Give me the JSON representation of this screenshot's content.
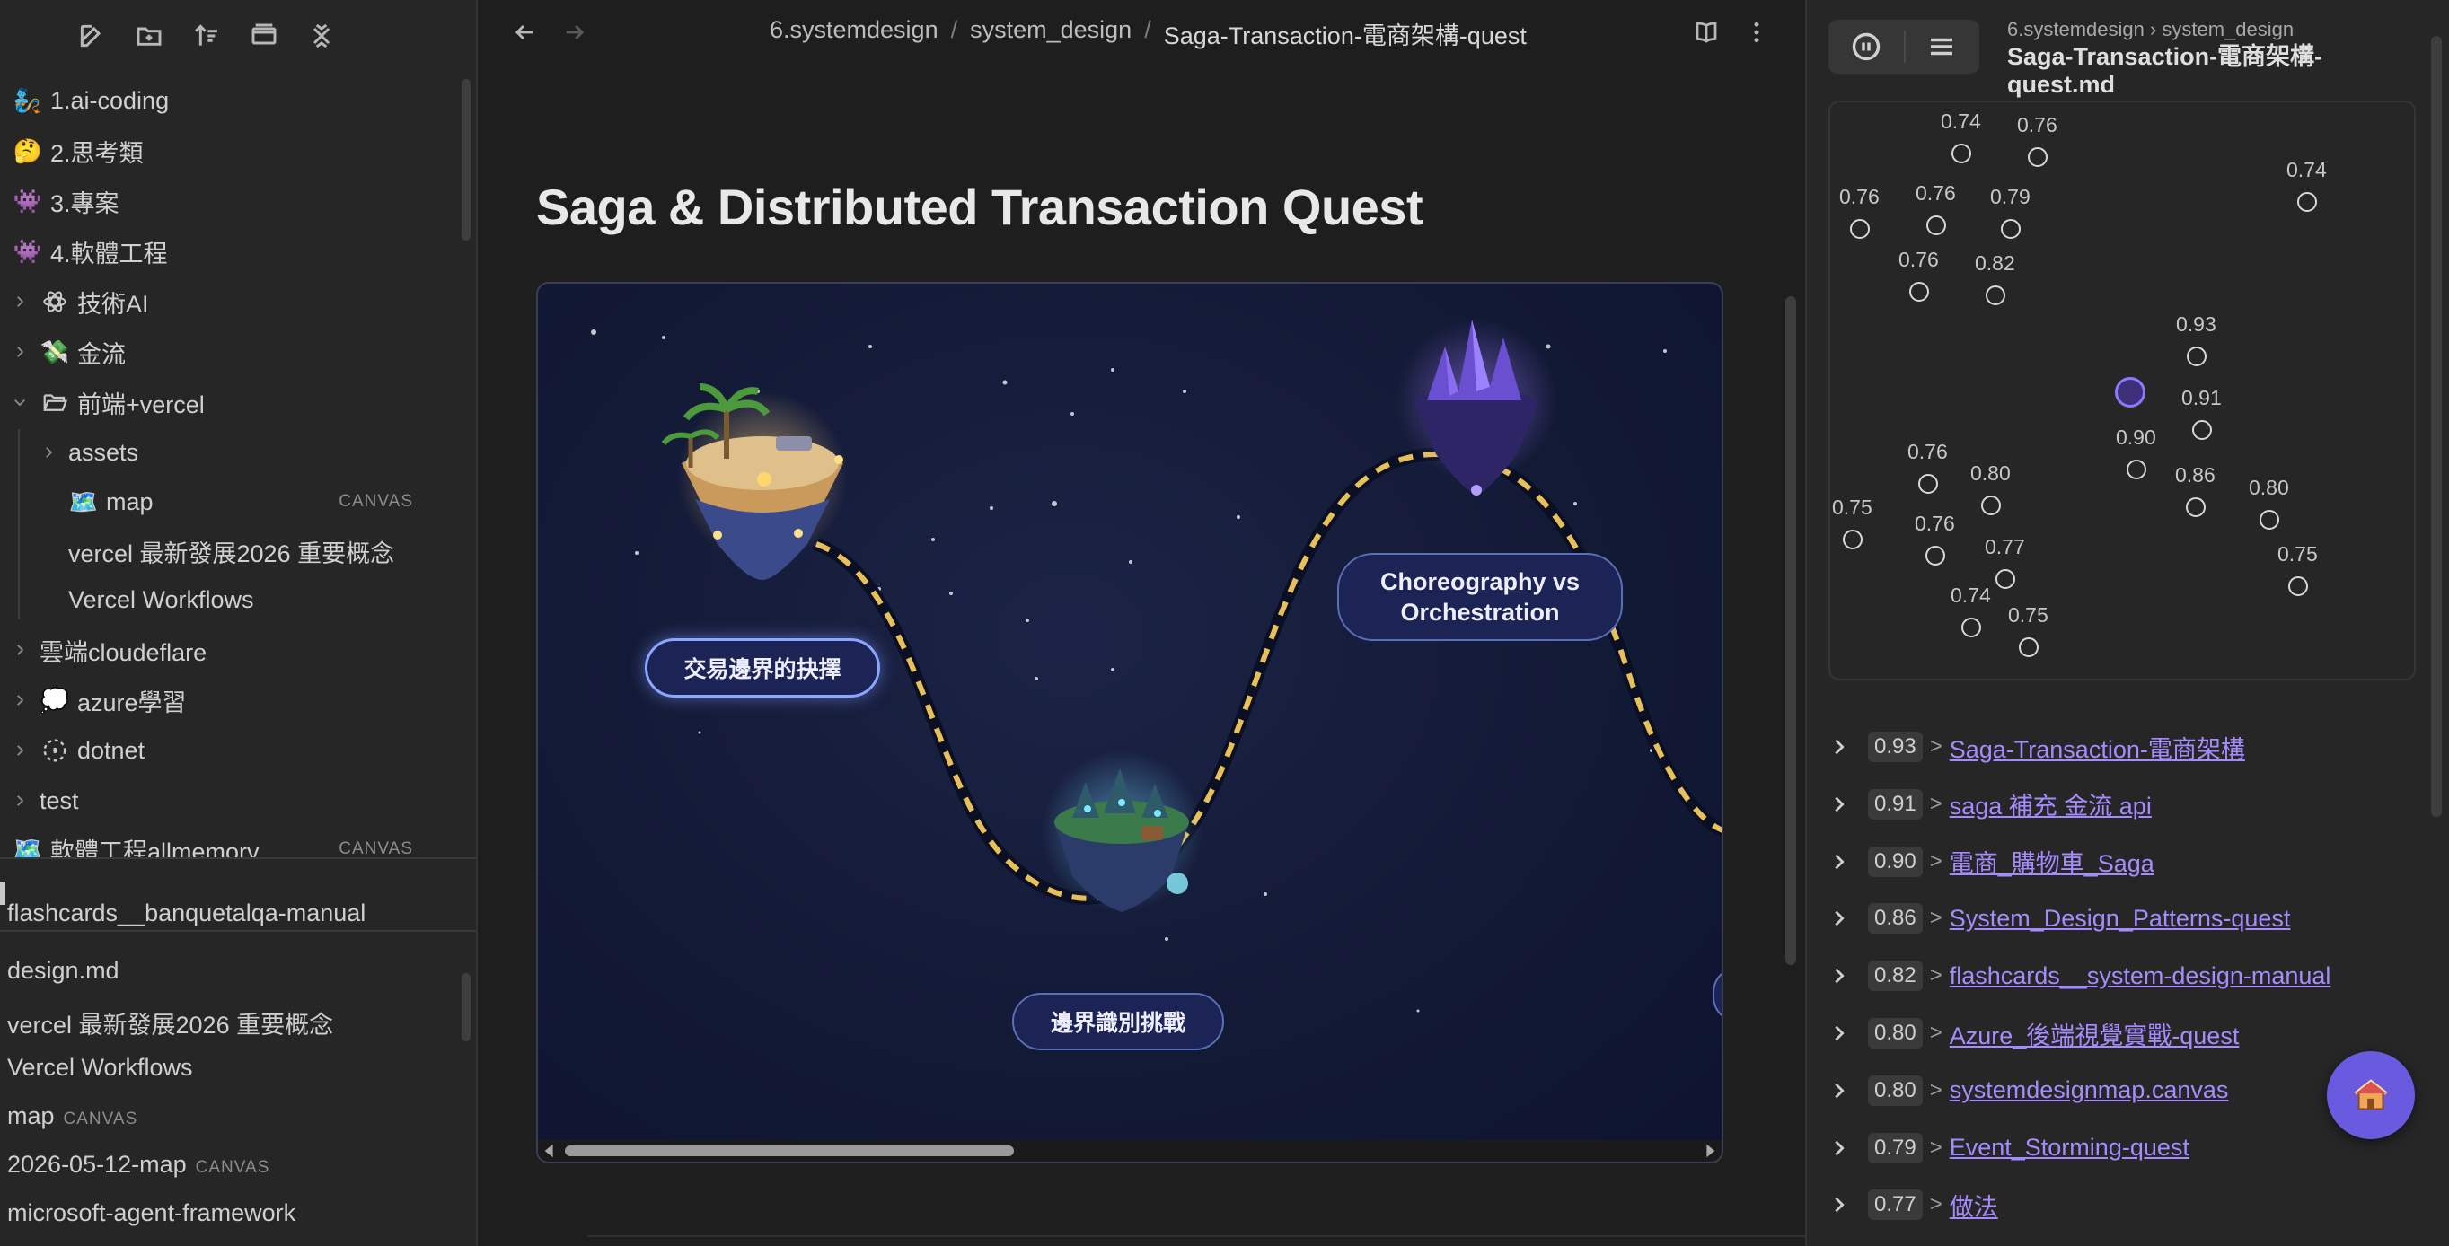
{
  "sidebar": {
    "toolbar": [
      "new-note-icon",
      "new-folder-icon",
      "sort-icon",
      "collapse-view-icon",
      "close-all-icon"
    ],
    "tree": [
      {
        "label": "1.ai-coding",
        "icon": "🧞",
        "depth": 0,
        "chev": "none"
      },
      {
        "label": "2.思考類",
        "icon": "🤔",
        "depth": 0,
        "chev": "none"
      },
      {
        "label": "3.專案",
        "icon": "👾",
        "depth": 0,
        "chev": "none"
      },
      {
        "label": "4.軟體工程",
        "icon": "👾",
        "depth": 0,
        "chev": "none"
      },
      {
        "label": "技術AI",
        "icon": "atom-icon",
        "depth": 0,
        "chev": "right"
      },
      {
        "label": "金流",
        "icon": "💸",
        "depth": 0,
        "chev": "right"
      },
      {
        "label": "前端+vercel",
        "icon": "folder-open-icon",
        "depth": 0,
        "chev": "down"
      },
      {
        "label": "assets",
        "icon": "",
        "depth": 1,
        "chev": "right"
      },
      {
        "label": "map",
        "icon": "🗺️",
        "depth": 1,
        "chev": "none",
        "badge": "CANVAS"
      },
      {
        "label": "vercel 最新發展2026 重要概念",
        "icon": "",
        "depth": 1,
        "chev": "none"
      },
      {
        "label": "Vercel Workflows",
        "icon": "",
        "depth": 1,
        "chev": "none"
      },
      {
        "label": "雲端cloudeflare",
        "icon": "",
        "depth": 0,
        "chev": "right"
      },
      {
        "label": "azure學習",
        "icon": "💭",
        "depth": 0,
        "chev": "right"
      },
      {
        "label": "dotnet",
        "icon": "dotted-circle-icon",
        "depth": 0,
        "chev": "right"
      },
      {
        "label": "test",
        "icon": "",
        "depth": 0,
        "chev": "right"
      },
      {
        "label": "軟體工程allmemory",
        "icon": "🗺️",
        "depth": 0,
        "chev": "none",
        "badge": "CANVAS"
      }
    ],
    "recent": [
      {
        "label": "flashcards__banquetalqa-manual",
        "badge": ""
      },
      {
        "label": "design.md",
        "badge": ""
      },
      {
        "label": "vercel 最新發展2026 重要概念",
        "badge": ""
      },
      {
        "label": "Vercel Workflows",
        "badge": ""
      },
      {
        "label": "map",
        "badge": "CANVAS"
      },
      {
        "label": "2026-05-12-map",
        "badge": "CANVAS"
      },
      {
        "label": "microsoft-agent-framework",
        "badge": ""
      }
    ]
  },
  "main": {
    "breadcrumb": [
      "6.systemdesign",
      "system_design",
      "Saga-Transaction-電商架構-quest"
    ],
    "breadcrumb_sep": "/",
    "title": "Saga & Distributed Transaction Quest",
    "map": {
      "labels": {
        "island1": "交易邊界的抉擇",
        "island2_line1": "Choreography vs",
        "island2_line2": "Orchestration",
        "island3": "邊界識別挑戰"
      },
      "colors": {
        "path": "#e8c05a",
        "label_bg": "#1b2454",
        "label_border": "#5a6fb8"
      }
    }
  },
  "right": {
    "path": "6.systemdesign › system_design",
    "file": "Saga-Transaction-電商架構-quest.md",
    "graph_nodes": [
      {
        "v": "0.74"
      },
      {
        "v": "0.76"
      },
      {
        "v": "0.74"
      },
      {
        "v": "0.76"
      },
      {
        "v": "0.76"
      },
      {
        "v": "0.79"
      },
      {
        "v": "0.76"
      },
      {
        "v": "0.82"
      },
      {
        "v": "0.93"
      },
      {
        "v": "0.91"
      },
      {
        "v": "0.90"
      },
      {
        "v": "0.76"
      },
      {
        "v": "0.80"
      },
      {
        "v": "0.86"
      },
      {
        "v": "0.80"
      },
      {
        "v": "0.75"
      },
      {
        "v": "0.76"
      },
      {
        "v": "0.77"
      },
      {
        "v": "0.75"
      },
      {
        "v": "0.74"
      },
      {
        "v": "0.75"
      }
    ],
    "results": [
      {
        "score": "0.93",
        "title": "Saga-Transaction-電商架構"
      },
      {
        "score": "0.91",
        "title": "saga 補充 金流 api"
      },
      {
        "score": "0.90",
        "title": "電商_購物車_Saga"
      },
      {
        "score": "0.86",
        "title": "System_Design_Patterns-quest"
      },
      {
        "score": "0.82",
        "title": "flashcards__system-design-manual"
      },
      {
        "score": "0.80",
        "title": "Azure_後端視覺實戰-quest"
      },
      {
        "score": "0.80",
        "title": "systemdesignmap.canvas"
      },
      {
        "score": "0.79",
        "title": "Event_Storming-quest"
      },
      {
        "score": "0.77",
        "title": "做法"
      }
    ],
    "accent": "#a48cff"
  }
}
